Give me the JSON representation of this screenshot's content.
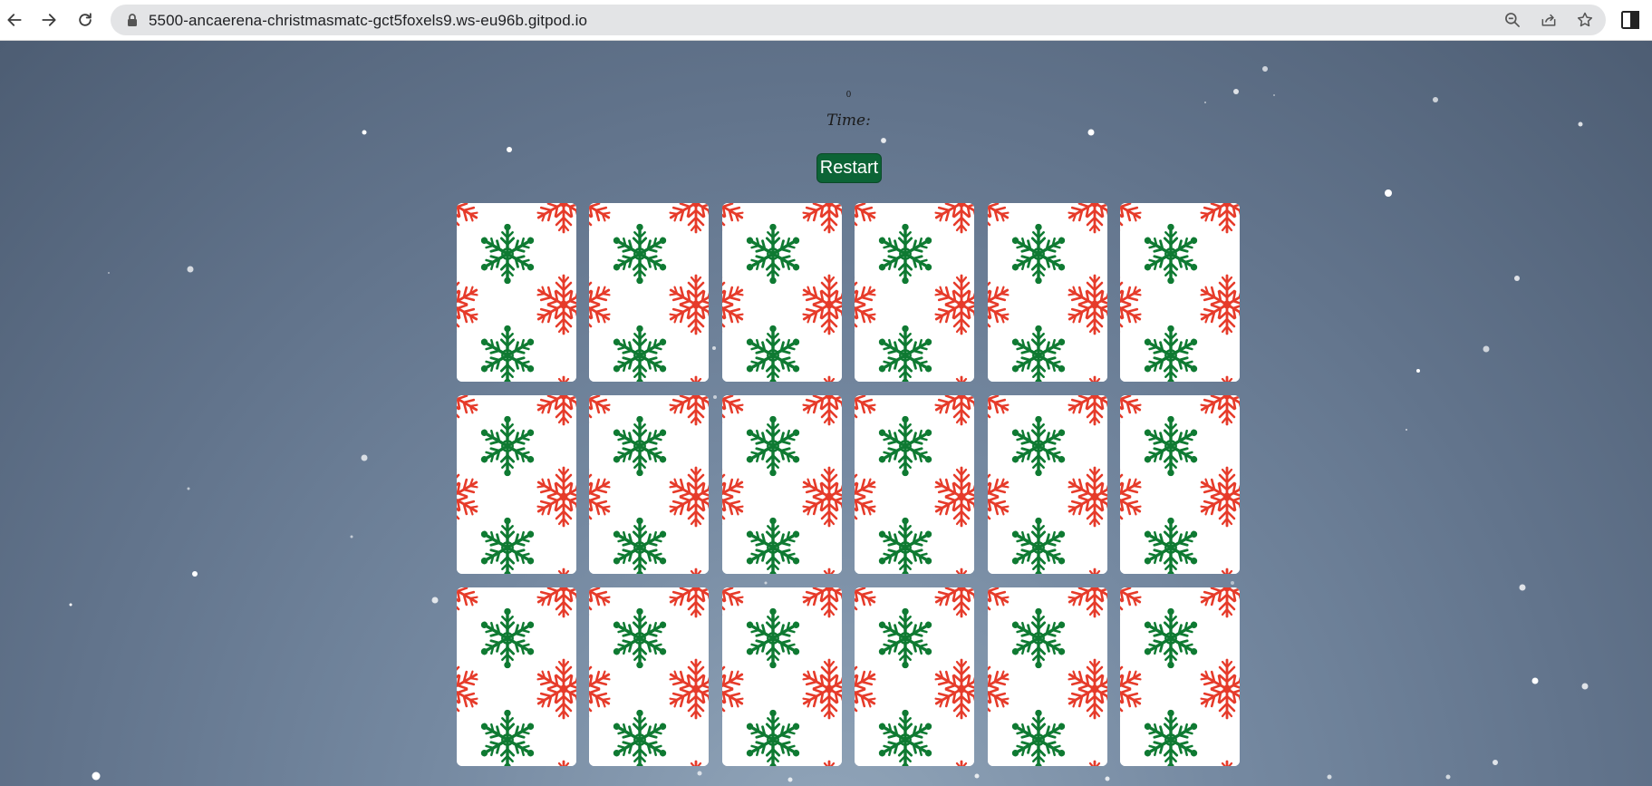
{
  "browser": {
    "url": "5500-ancaerena-christmasmatc-gct5foxels9.ws-eu96b.gitpod.io",
    "icons": [
      "back-arrow-icon",
      "forward-arrow-icon",
      "reload-icon",
      "lock-icon",
      "zoom-out-icon",
      "share-icon",
      "bookmark-star-icon",
      "side-panel-icon"
    ]
  },
  "game": {
    "moves": "0",
    "time_label": "Time:",
    "restart_label": "Restart",
    "card_back_colors": {
      "green": "#0f7a32",
      "red": "#e63b2a"
    },
    "cards": [
      {
        "state": "face-down"
      },
      {
        "state": "face-down"
      },
      {
        "state": "face-down"
      },
      {
        "state": "face-down"
      },
      {
        "state": "face-down"
      },
      {
        "state": "face-down"
      },
      {
        "state": "face-down"
      },
      {
        "state": "face-down"
      },
      {
        "state": "face-down"
      },
      {
        "state": "face-down"
      },
      {
        "state": "face-down"
      },
      {
        "state": "face-down"
      },
      {
        "state": "face-down"
      },
      {
        "state": "face-down"
      },
      {
        "state": "face-down"
      },
      {
        "state": "face-down"
      },
      {
        "state": "face-down"
      },
      {
        "state": "face-down"
      }
    ]
  }
}
